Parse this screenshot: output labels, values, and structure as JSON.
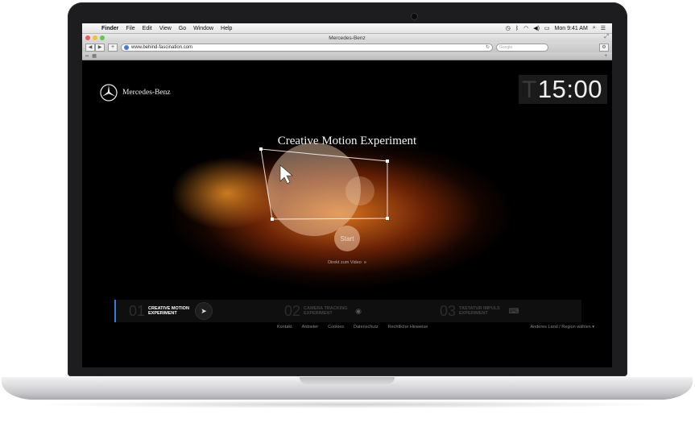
{
  "menubar": {
    "apple": "",
    "items": [
      "Finder",
      "File",
      "Edit",
      "View",
      "Go",
      "Window",
      "Help"
    ],
    "clock": "Mon 9:41 AM"
  },
  "browser": {
    "window_title": "Mercedes-Benz",
    "url": "www.behind-fascination.com",
    "search_placeholder": "Google"
  },
  "site": {
    "brand": "Mercedes-Benz",
    "timer_letter": "T",
    "timer": "15:00",
    "headline": "Creative Motion Experiment",
    "start_label": "Start",
    "direct_link": "Direkt zum Video",
    "direct_chevron": "»",
    "experiments": [
      {
        "num": "01",
        "label": "CREATIVE MOTION EXPERIMENT",
        "icon": "cursor-icon",
        "glyph": "➤",
        "active": true
      },
      {
        "num": "02",
        "label": "CAMERA TRACKING EXPERIMENT",
        "icon": "webcam-icon",
        "glyph": "◉",
        "active": false
      },
      {
        "num": "03",
        "label": "TASTATUR IMPULS EXPERIMENT",
        "icon": "keyboard-icon",
        "glyph": "⌨",
        "active": false
      }
    ],
    "footer_links": [
      "Kontakt",
      "Anbieter",
      "Cookies",
      "Datenschutz",
      "Rechtliche Hinweise"
    ],
    "country_select": "Anderes Land / Region wählen"
  },
  "colors": {
    "accent_blue": "#3a7bd5",
    "glow_orange": "#e2781e"
  }
}
